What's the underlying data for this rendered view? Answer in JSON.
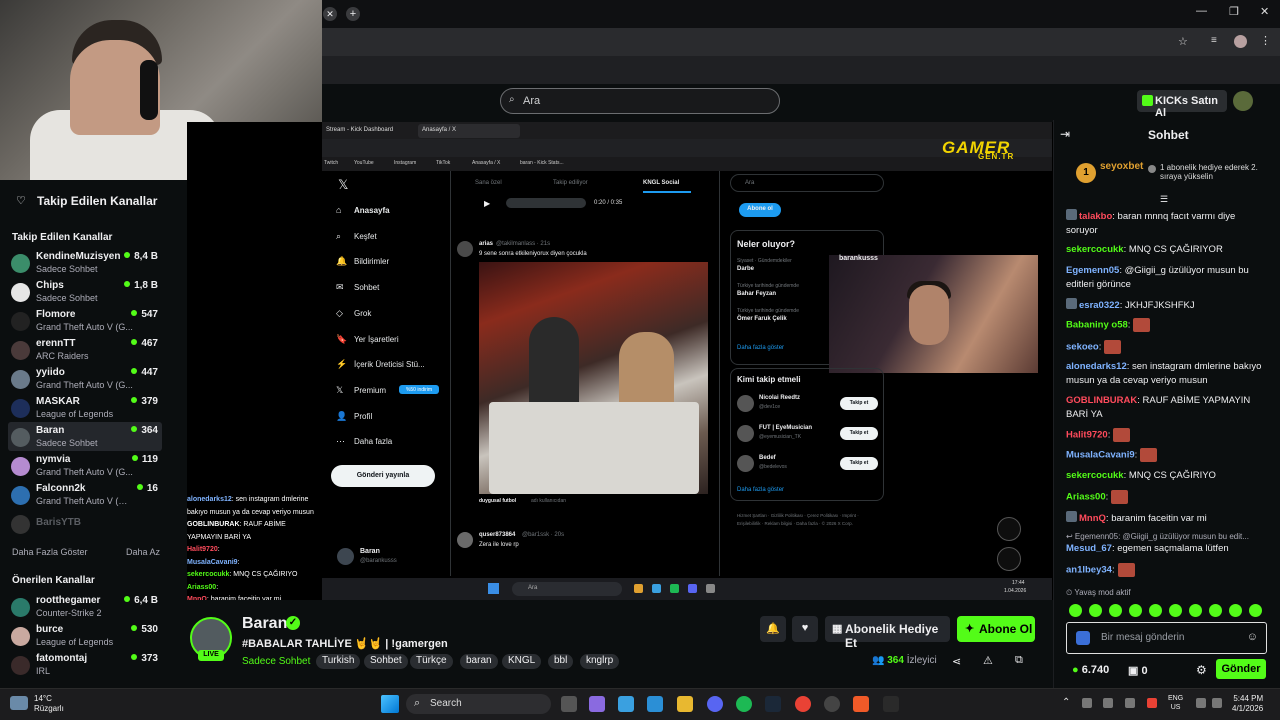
{
  "browser": {
    "new_tab_icon": "plus-icon",
    "window_controls": [
      "minimize",
      "maximize",
      "close"
    ]
  },
  "header": {
    "search_placeholder": "Ara",
    "kicks_button": "KICKs Satın Al"
  },
  "sidebar": {
    "followed_header": "Takip Edilen Kanallar",
    "section_followed": "Takip Edilen Kanallar",
    "channels": [
      {
        "name": "KendineMuzisyen",
        "game": "Sadece Sohbet",
        "viewers": "8,4 B",
        "color": "#3b8d6a"
      },
      {
        "name": "Chips",
        "game": "Sadece Sohbet",
        "viewers": "1,8 B",
        "color": "#e6e6e6"
      },
      {
        "name": "Flomore",
        "game": "Grand Theft Auto V (G...",
        "viewers": "547",
        "color": "#222222"
      },
      {
        "name": "erennTT",
        "game": "ARC Raiders",
        "viewers": "467",
        "color": "#4a3a3a"
      },
      {
        "name": "yyiido",
        "game": "Grand Theft Auto V (G...",
        "viewers": "447",
        "color": "#6a7a8a"
      },
      {
        "name": "MASKAR",
        "game": "League of Legends",
        "viewers": "379",
        "color": "#1d2e5a"
      },
      {
        "name": "Baran",
        "game": "Sadece Sohbet",
        "viewers": "364",
        "color": "#545c60"
      },
      {
        "name": "nymvia",
        "game": "Grand Theft Auto V (G...",
        "viewers": "119",
        "color": "#b58bd0"
      },
      {
        "name": "Falconn2k",
        "game": "Grand Theft Auto V (GTA)",
        "viewers": "16",
        "color": "#2d6fb0"
      },
      {
        "name": "BarisYTB",
        "game": "",
        "viewers": "",
        "color": "#333333"
      }
    ],
    "show_more": "Daha Fazla Göster",
    "show_less": "Daha Az",
    "section_recommended": "Önerilen Kanallar",
    "recommended": [
      {
        "name": "rootthegamer",
        "game": "Counter-Strike 2",
        "viewers": "6,4 B",
        "color": "#2a7a6a"
      },
      {
        "name": "burce",
        "game": "League of Legends",
        "viewers": "530",
        "color": "#c9a9a0"
      },
      {
        "name": "fatomontaj",
        "game": "IRL",
        "viewers": "373",
        "color": "#3a2a2a"
      }
    ]
  },
  "stream_overlay": {
    "tabs": [
      "Stream - Kick Dashboard",
      "Anasayfa / X"
    ],
    "bookmarks": [
      "Twitch",
      "YouTube",
      "Instagram",
      "TikTok",
      "Anasayfa / X",
      "baran - Kick Stats..."
    ],
    "logo_text": "GAMER",
    "logo_sub": "GEN.TR",
    "x_nav": [
      "Anasayfa",
      "Keşfet",
      "Bildirimler",
      "Sohbet",
      "Grok",
      "Yer İşaretleri",
      "İçerik Üreticisi Stü...",
      "Premium",
      "Profil",
      "Daha fazla"
    ],
    "premium_badge": "%50 indirim",
    "post_button": "Gönderi yayınla",
    "feed_tabs": [
      "Sana özel",
      "Takip ediliyor",
      "KNGL Social"
    ],
    "video_time": "0:20 / 0:35",
    "tweet_user": "arias",
    "tweet_handle": "@takilmanlass · 21s",
    "tweet_text": "9 sene sonra etkileniyorux diyen çocukla",
    "tweet_below": "duygusal futbol",
    "tweet_below2": "adı kullanıcıdan",
    "reply_user": "quser873864",
    "reply_handle": "@bar1ssk · 20s",
    "reply_text": "Zera ile love rp",
    "right_search": "Ara",
    "subscribe_btn": "Abone ol",
    "trends_title": "Neler oluyor?",
    "trends": [
      {
        "meta": "Siyaset · Gündemdekiler",
        "name": "Darbe"
      },
      {
        "meta": "Türkiye tarihinde gündemde",
        "name": "Bahar Feyzan"
      },
      {
        "meta": "Türkiye tarihinde gündemde",
        "name": "Ömer Faruk Çelik"
      }
    ],
    "trends_more": "Daha fazla göster",
    "who_title": "Kimi takip etmeli",
    "who": [
      {
        "name": "Nicolai Reedtz",
        "handle": "@dev1ce"
      },
      {
        "name": "FUT | EyeMusician",
        "handle": "@eyemusician_TK"
      },
      {
        "name": "Bedef",
        "handle": "@bedelevos"
      }
    ],
    "follow_label": "Takip et",
    "who_more": "Daha fazla göster",
    "footer_links": "Hizmet Şartları · Gizlilik Politikası · Çerez Politikası · Imprint · Erişilebilirlik · Reklam bilgisi · Daha fazla · © 2026 X Corp.",
    "cam_label": "barankusss",
    "mini_name": "Baran",
    "mini_handle": "@barankusss",
    "taskbar_search": "Ara",
    "taskbar_time": "17:44",
    "taskbar_date": "1.04.2026",
    "overlay_chat": [
      {
        "user": "alonedarks12",
        "text": ": sen instagram dmlerine bakıyo musun ya da cevap veriyo musun",
        "color": "#7fb3ff"
      },
      {
        "user": "GOBLINBURAK",
        "text": ": RAUF ABİME YAPMAYIN BARİ YA",
        "color": "#ffffff"
      },
      {
        "user": "Halit9720",
        "text": ":",
        "color": "#ff4b5c"
      },
      {
        "user": "MusalaCavani9",
        "text": ":",
        "color": "#7fb3ff"
      },
      {
        "user": "sekercocukk",
        "text": ": MNQ CS ÇAĞIRIYO",
        "color": "#53fc18"
      },
      {
        "user": "Ariass00",
        "text": ":",
        "color": "#53fc18"
      },
      {
        "user": "MnnQ",
        "text": ": baranim faceitin var mi",
        "color": "#ff4b5c"
      }
    ]
  },
  "channel": {
    "name": "Baran",
    "live_label": "LIVE",
    "title": "#BABALAR TAHLİYE 🤘🤘 | !gamergen",
    "category": "Sadece Sohbet",
    "tags": [
      "Turkish",
      "Sohbet",
      "Türkçe",
      "baran",
      "KNGL",
      "bbl",
      "knglrp"
    ],
    "gift_button": "Abonelik Hediye Et",
    "subscribe_button": "Abone Ol",
    "viewers": "364",
    "viewers_label": "İzleyici"
  },
  "chat": {
    "title": "Sohbet",
    "pinned_user": "seyoxbet",
    "pinned_count": "1",
    "pinned_text": "1 abonelik hediye ederek 2. sıraya yükselin",
    "messages": [
      {
        "user": "talakbo",
        "text": ": baran mnnq facıt varmı diye soruyor",
        "color": "#ff4b5c",
        "badge": true
      },
      {
        "user": "sekercocukk",
        "text": ": MNQ CS ÇAĞIRIYOR",
        "color": "#53fc18"
      },
      {
        "user": "Egemenn05",
        "text": ": @Giigii_g üzülüyor musun bu editleri görünce",
        "color": "#7fb3ff"
      },
      {
        "user": "esra0322",
        "text": ": JKHJFJKSHFKJ",
        "color": "#7fb3ff",
        "badge": true
      },
      {
        "user": "Babaniny o58",
        "text": ":",
        "color": "#53fc18",
        "emote": true
      },
      {
        "user": "sekoeo",
        "text": ":",
        "color": "#7fb3ff",
        "emote": true
      },
      {
        "user": "alonedarks12",
        "text": ": sen instagram dmlerine bakıyo musun ya da cevap veriyo musun",
        "color": "#7fb3ff"
      },
      {
        "user": "GOBLINBURAK",
        "text": ": RAUF ABİME YAPMAYIN BARİ YA",
        "color": "#ff4b5c"
      },
      {
        "user": "Halit9720",
        "text": ":",
        "color": "#ff4b5c",
        "emote": true
      },
      {
        "user": "MusalaCavani9",
        "text": ":",
        "color": "#7fb3ff",
        "emote": true
      },
      {
        "user": "sekercocukk",
        "text": ": MNQ CS ÇAĞIRIYO",
        "color": "#53fc18"
      },
      {
        "user": "Ariass00",
        "text": ":",
        "color": "#53fc18",
        "emote": true
      },
      {
        "user": "MnnQ",
        "text": ": baranim faceitin var mi",
        "color": "#ff4b5c",
        "badge": true
      },
      {
        "user": "",
        "text": "↩ Egemenn05: @Giigii_g üzülüyor musun bu edit...",
        "color": "#adadb8"
      },
      {
        "user": "Mesud_67",
        "text": ": egemen saçmalama lütfen",
        "color": "#7fb3ff"
      },
      {
        "user": "an1lbey34",
        "text": ":",
        "color": "#7fb3ff",
        "emote": true
      }
    ],
    "slow_mode": "Yavaş mod aktif",
    "input_placeholder": "Bir mesaj gönderin",
    "kicks_balance": "6.740",
    "second_balance": "0",
    "send_button": "Gönder"
  },
  "taskbar": {
    "weather_temp": "14°C",
    "weather_text": "Rüzgarlı",
    "search": "Search",
    "lang1": "ENG",
    "lang2": "US",
    "time": "5:44 PM",
    "date": "4/1/2026"
  },
  "colors": {
    "kick_green": "#53fc18",
    "bg": "#0b0e0f",
    "panel": "#24272c"
  }
}
